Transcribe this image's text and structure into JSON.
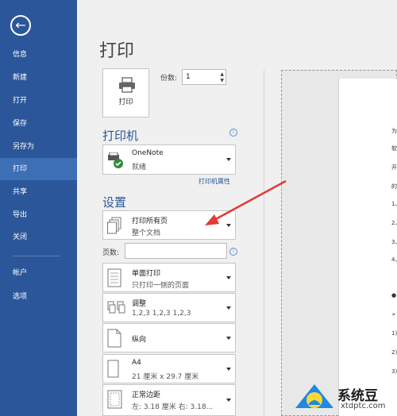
{
  "sidebar": {
    "back_icon": "←",
    "items": [
      {
        "label": "信息"
      },
      {
        "label": "新建"
      },
      {
        "label": "打开"
      },
      {
        "label": "保存"
      },
      {
        "label": "另存为"
      },
      {
        "label": "打印"
      },
      {
        "label": "共享"
      },
      {
        "label": "导出"
      },
      {
        "label": "关闭"
      },
      {
        "label": "帐户"
      },
      {
        "label": "选项"
      }
    ],
    "active_color": "#3d6fb6",
    "bg_color": "#2b579a"
  },
  "main": {
    "title": "打印",
    "print_button_label": "打印",
    "copies_label": "份数:",
    "copies_value": "1",
    "printer_section": "打印机",
    "printer": {
      "name": "OneNote",
      "status": "就绪"
    },
    "printer_properties": "打印机属性",
    "settings_section": "设置",
    "pages_label": "页数:",
    "settings": [
      {
        "line1": "打印所有页",
        "line2": "整个文档",
        "icon": "pages-icon"
      },
      {
        "line1": "单面打印",
        "line2": "只打印一侧的页面",
        "icon": "single-sided-icon"
      },
      {
        "line1": "调整",
        "line2": "1,2,3    1,2,3    1,2,3",
        "icon": "collate-icon"
      },
      {
        "line1": "纵向",
        "icon": "portrait-icon"
      },
      {
        "line1": "A4",
        "line2": "21 厘米 x 29.7 厘米",
        "icon": "paper-size-icon"
      },
      {
        "line1": "正常边距",
        "line2": "左: 3.18 厘米    右: 3.18...",
        "icon": "margins-icon"
      }
    ]
  },
  "preview": {
    "lines": [
      "为",
      "软",
      "开",
      "的",
      "1、",
      "2、",
      "3、",
      "4、",
      "●",
      "➢",
      "1)",
      "2)",
      "3)"
    ]
  },
  "watermark": {
    "text": "系统豆",
    "url": "xtdptc.com"
  }
}
